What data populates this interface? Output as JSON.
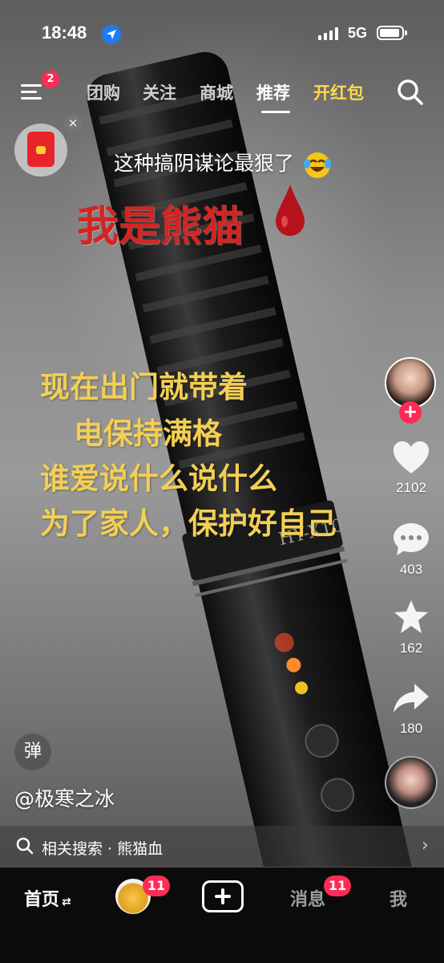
{
  "status_bar": {
    "time": "18:48",
    "network": "5G",
    "location_icon": "location-arrow-icon",
    "signal_icon": "signal-bars-icon",
    "battery_icon": "battery-icon"
  },
  "top_nav": {
    "menu_badge": "2",
    "tabs": [
      {
        "label": "团购",
        "active": false
      },
      {
        "label": "关注",
        "active": false
      },
      {
        "label": "商城",
        "active": false
      },
      {
        "label": "推荐",
        "active": true
      },
      {
        "label": "开红包",
        "active": false
      }
    ],
    "search_icon": "search-icon"
  },
  "red_packet": {
    "close_label": "×"
  },
  "video": {
    "caption_top": "这种搞阴谋论最狠了",
    "title": "我是熊猫",
    "lines": [
      "现在出门就带着",
      "电保持满格",
      "谁爱说什么说什么",
      "为了家人，保护好自己"
    ],
    "object_text": "HY-X10"
  },
  "side_actions": {
    "follow_label": "+",
    "like_count": "2102",
    "comment_count": "403",
    "favorite_count": "162",
    "share_count": "180"
  },
  "danmu_label": "弹",
  "author": "@极寒之冰",
  "related_search": {
    "text": "相关搜索 · 熊猫血",
    "chevron": "›"
  },
  "bottom_nav": {
    "home": "首页",
    "refresh_glyph": "⇄",
    "friends_badge": "11",
    "messages": "消息",
    "messages_badge": "11",
    "me": "我"
  },
  "colors": {
    "accent_red": "#fe2c55",
    "hongbao_yellow": "#ffd84d",
    "caption_yellow": "#f3cf54",
    "title_red": "#d42424"
  }
}
